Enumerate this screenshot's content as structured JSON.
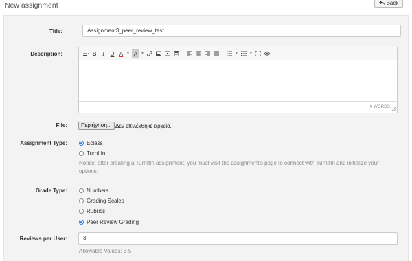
{
  "header": {
    "title": "New assignment",
    "back_label": "Back"
  },
  "form": {
    "title": {
      "label": "Title:",
      "value": "Assignment3_peer_review_test"
    },
    "description": {
      "label": "Description:",
      "word_count": "0 WORDS"
    },
    "toolbar": {
      "items": [
        "paragraph-format",
        "bold",
        "italic",
        "underline",
        "font-color",
        "background-color",
        "link",
        "image",
        "media",
        "template",
        "align-left",
        "align-center",
        "align-right",
        "justify",
        "bullet-list",
        "numbered-list",
        "fullscreen",
        "preview"
      ],
      "bold": "B",
      "italic": "I",
      "underline": "U",
      "font_color": "A",
      "bg_color": "A"
    },
    "file": {
      "label": "File:",
      "button": "Περιήγηση...",
      "status": "Δεν επιλέχθηκε αρχείο."
    },
    "assignment_type": {
      "label": "Assignment Type:",
      "options": [
        {
          "label": "Eclass",
          "selected": true
        },
        {
          "label": "TurnItIn",
          "selected": false
        }
      ],
      "notice": "Notice: after creating a TurnItIn assignment, you must visit the assignment's page to connect with TurnItIn and initialize your options."
    },
    "grade_type": {
      "label": "Grade Type:",
      "options": [
        {
          "label": "Numbers",
          "selected": false
        },
        {
          "label": "Grading Scales",
          "selected": false
        },
        {
          "label": "Rubrics",
          "selected": false
        },
        {
          "label": "Peer Review Grading",
          "selected": true
        }
      ]
    },
    "reviews_per_user": {
      "label": "Reviews per User:",
      "value": "3",
      "hint": "Allowable Values: 3-5"
    }
  },
  "colors": {
    "accent": "#2f7ae5",
    "panel_bg": "#f3f3f3"
  }
}
